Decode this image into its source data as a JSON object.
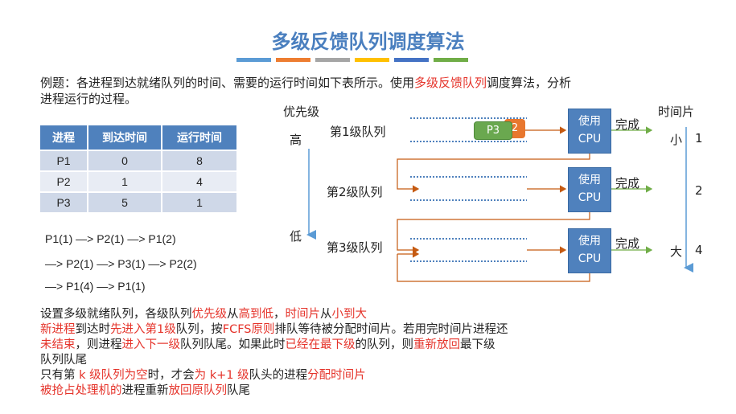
{
  "title": "多级反馈队列调度算法",
  "title_bar_colors": [
    "#5b9bd5",
    "#ed7d31",
    "#a5a5a5",
    "#ffc000",
    "#4472c4",
    "#70ad47"
  ],
  "intro": {
    "part1": "例题：各进程到达就绪队列的时间、需要的运行时间如下表所示。使用",
    "highlight": "多级反馈队列",
    "part2": "调度算法，分析",
    "line2": "进程运行的过程。"
  },
  "table": {
    "headers": [
      "进程",
      "到达时间",
      "运行时间"
    ],
    "rows": [
      [
        "P1",
        "0",
        "8"
      ],
      [
        "P2",
        "1",
        "4"
      ],
      [
        "P3",
        "5",
        "1"
      ]
    ]
  },
  "sequence": [
    "P1(1) —> P2(1) —> P1(2)",
    "—> P2(1) —> P3(1) —> P2(2)",
    "—> P1(4) —> P1(1)"
  ],
  "diagram": {
    "priority_label": "优先级",
    "high": "高",
    "low": "低",
    "queues": [
      "第1级队列",
      "第2级队列",
      "第3级队列"
    ],
    "cpu_line1": "使用",
    "cpu_line2": "CPU",
    "done": "完成",
    "slice_label": "时间片",
    "small": "小",
    "big": "大",
    "slices": [
      "1",
      "2",
      "4"
    ],
    "proc_p3": "P3",
    "proc_p2": "2"
  },
  "notes": {
    "l1": [
      "设置多级就绪队列，各级队列",
      "优先级",
      "从",
      "高到低",
      "，",
      "时间片",
      "从",
      "小到大"
    ],
    "l2": [
      "新进程",
      "到达时",
      "先进入第1级",
      "队列，按",
      "FCFS原则",
      "排队等待被分配时间片。若用完时间片进程还"
    ],
    "l3": [
      "未结束",
      "，则进程",
      "进入下一级",
      "队列队尾。如果此时",
      "已经在最下级",
      "的队列，则",
      "重新放回",
      "最下级"
    ],
    "l4": "队列队尾",
    "l5": [
      "只有第 ",
      "k 级队列为空",
      "时，才会",
      "为 k+1 级",
      "队头的进程",
      "分配时间片"
    ],
    "l6": [
      "被抢占处理机的",
      "进程重新",
      "放回原队列",
      "队尾"
    ]
  }
}
